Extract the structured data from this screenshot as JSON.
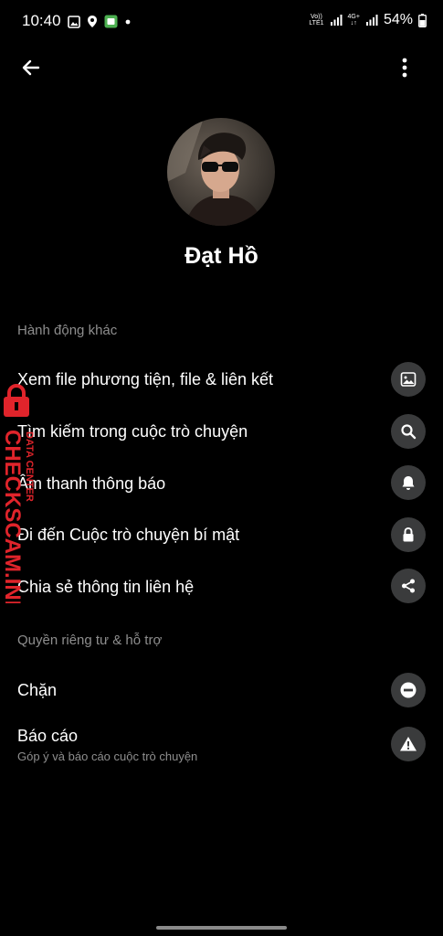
{
  "status_bar": {
    "time": "10:40",
    "net_volte": "Vo))",
    "net_lte": "LTE1",
    "net_4g": "4G+",
    "battery": "54%"
  },
  "profile": {
    "name": "Đạt Hồ"
  },
  "sections": {
    "more_actions": {
      "title": "Hành động khác",
      "items": [
        {
          "label": "Xem file phương tiện, file & liên kết",
          "icon": "image-icon"
        },
        {
          "label": "Tìm kiếm trong cuộc trò chuyện",
          "icon": "search-icon"
        },
        {
          "label": "Âm thanh thông báo",
          "icon": "bell-icon"
        },
        {
          "label": "Đi đến Cuộc trò chuyện bí mật",
          "icon": "lock-icon"
        },
        {
          "label": "Chia sẻ thông tin liên hệ",
          "icon": "share-icon"
        }
      ]
    },
    "privacy": {
      "title": "Quyền riêng tư & hỗ trợ",
      "items": [
        {
          "label": "Chặn",
          "icon": "block-icon"
        },
        {
          "label": "Báo cáo",
          "sublabel": "Góp ý và báo cáo cuộc trò chuyện",
          "icon": "warning-icon"
        }
      ]
    }
  },
  "watermark": {
    "main": "CHECKSCAM.INFO",
    "sub": "DATA CENTER",
    "color": "#e0242b"
  }
}
